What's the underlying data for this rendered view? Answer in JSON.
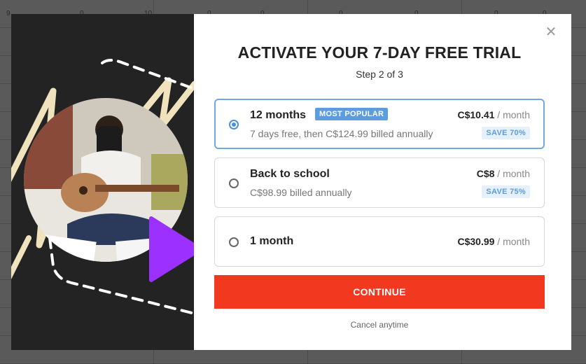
{
  "background": {
    "column_numbers": [
      "9",
      "0",
      "10",
      "0",
      "0",
      "0",
      "0",
      "0",
      "0"
    ]
  },
  "modal": {
    "title": "ACTIVATE YOUR 7-DAY FREE TRIAL",
    "step": "Step 2 of 3",
    "close_icon": "close-icon",
    "plans": [
      {
        "name": "12 months",
        "badge": "MOST POPULAR",
        "price": "C$10.41",
        "period": "/ month",
        "subtitle": "7 days free, then C$124.99 billed annually",
        "save": "SAVE 70%",
        "selected": true
      },
      {
        "name": "Back to school",
        "price": "C$8",
        "period": "/ month",
        "subtitle": "C$98.99 billed annually",
        "save": "SAVE 75%",
        "selected": false
      },
      {
        "name": "1 month",
        "price": "C$30.99",
        "period": "/ month",
        "selected": false
      }
    ],
    "continue_label": "CONTINUE",
    "cancel_text": "Cancel anytime"
  },
  "colors": {
    "accent": "#f2381f",
    "badge": "#5b9de0",
    "selected_border": "#74a8d8",
    "play": "#9b30ff"
  }
}
